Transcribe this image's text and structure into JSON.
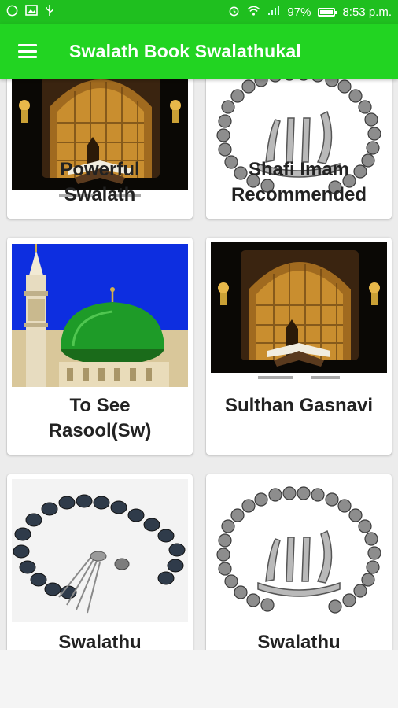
{
  "status_bar": {
    "battery_percent": "97%",
    "time": "8:53 p.m.",
    "battery_level": 0.97,
    "icons": [
      "whatsapp-icon",
      "image-icon",
      "usb-icon",
      "alarm-icon",
      "wifi-icon",
      "signal-icon",
      "battery-icon"
    ]
  },
  "app_bar": {
    "title": "Swalath Book Swalathukal",
    "menu_icon": "hamburger-menu-icon",
    "color": "#22d422"
  },
  "cards": [
    {
      "label_line1": "Powerful",
      "label_line2": "Swalath",
      "image": "quran-lantern-image"
    },
    {
      "label_line1": "Shafi Imam",
      "label_line2": "Recommended",
      "image": "allah-tasbih-image"
    },
    {
      "label_line1": "To See",
      "label_line2": "Rasool(Sw)",
      "image": "green-dome-mosque-image"
    },
    {
      "label_line1": "Sulthan Gasnavi",
      "label_line2": "",
      "image": "quran-lantern-image"
    },
    {
      "label_line1": "Swalathu",
      "label_line2": "",
      "image": "dark-tasbih-image"
    },
    {
      "label_line1": "Swalathu",
      "label_line2": "",
      "image": "allah-tasbih-image"
    }
  ]
}
